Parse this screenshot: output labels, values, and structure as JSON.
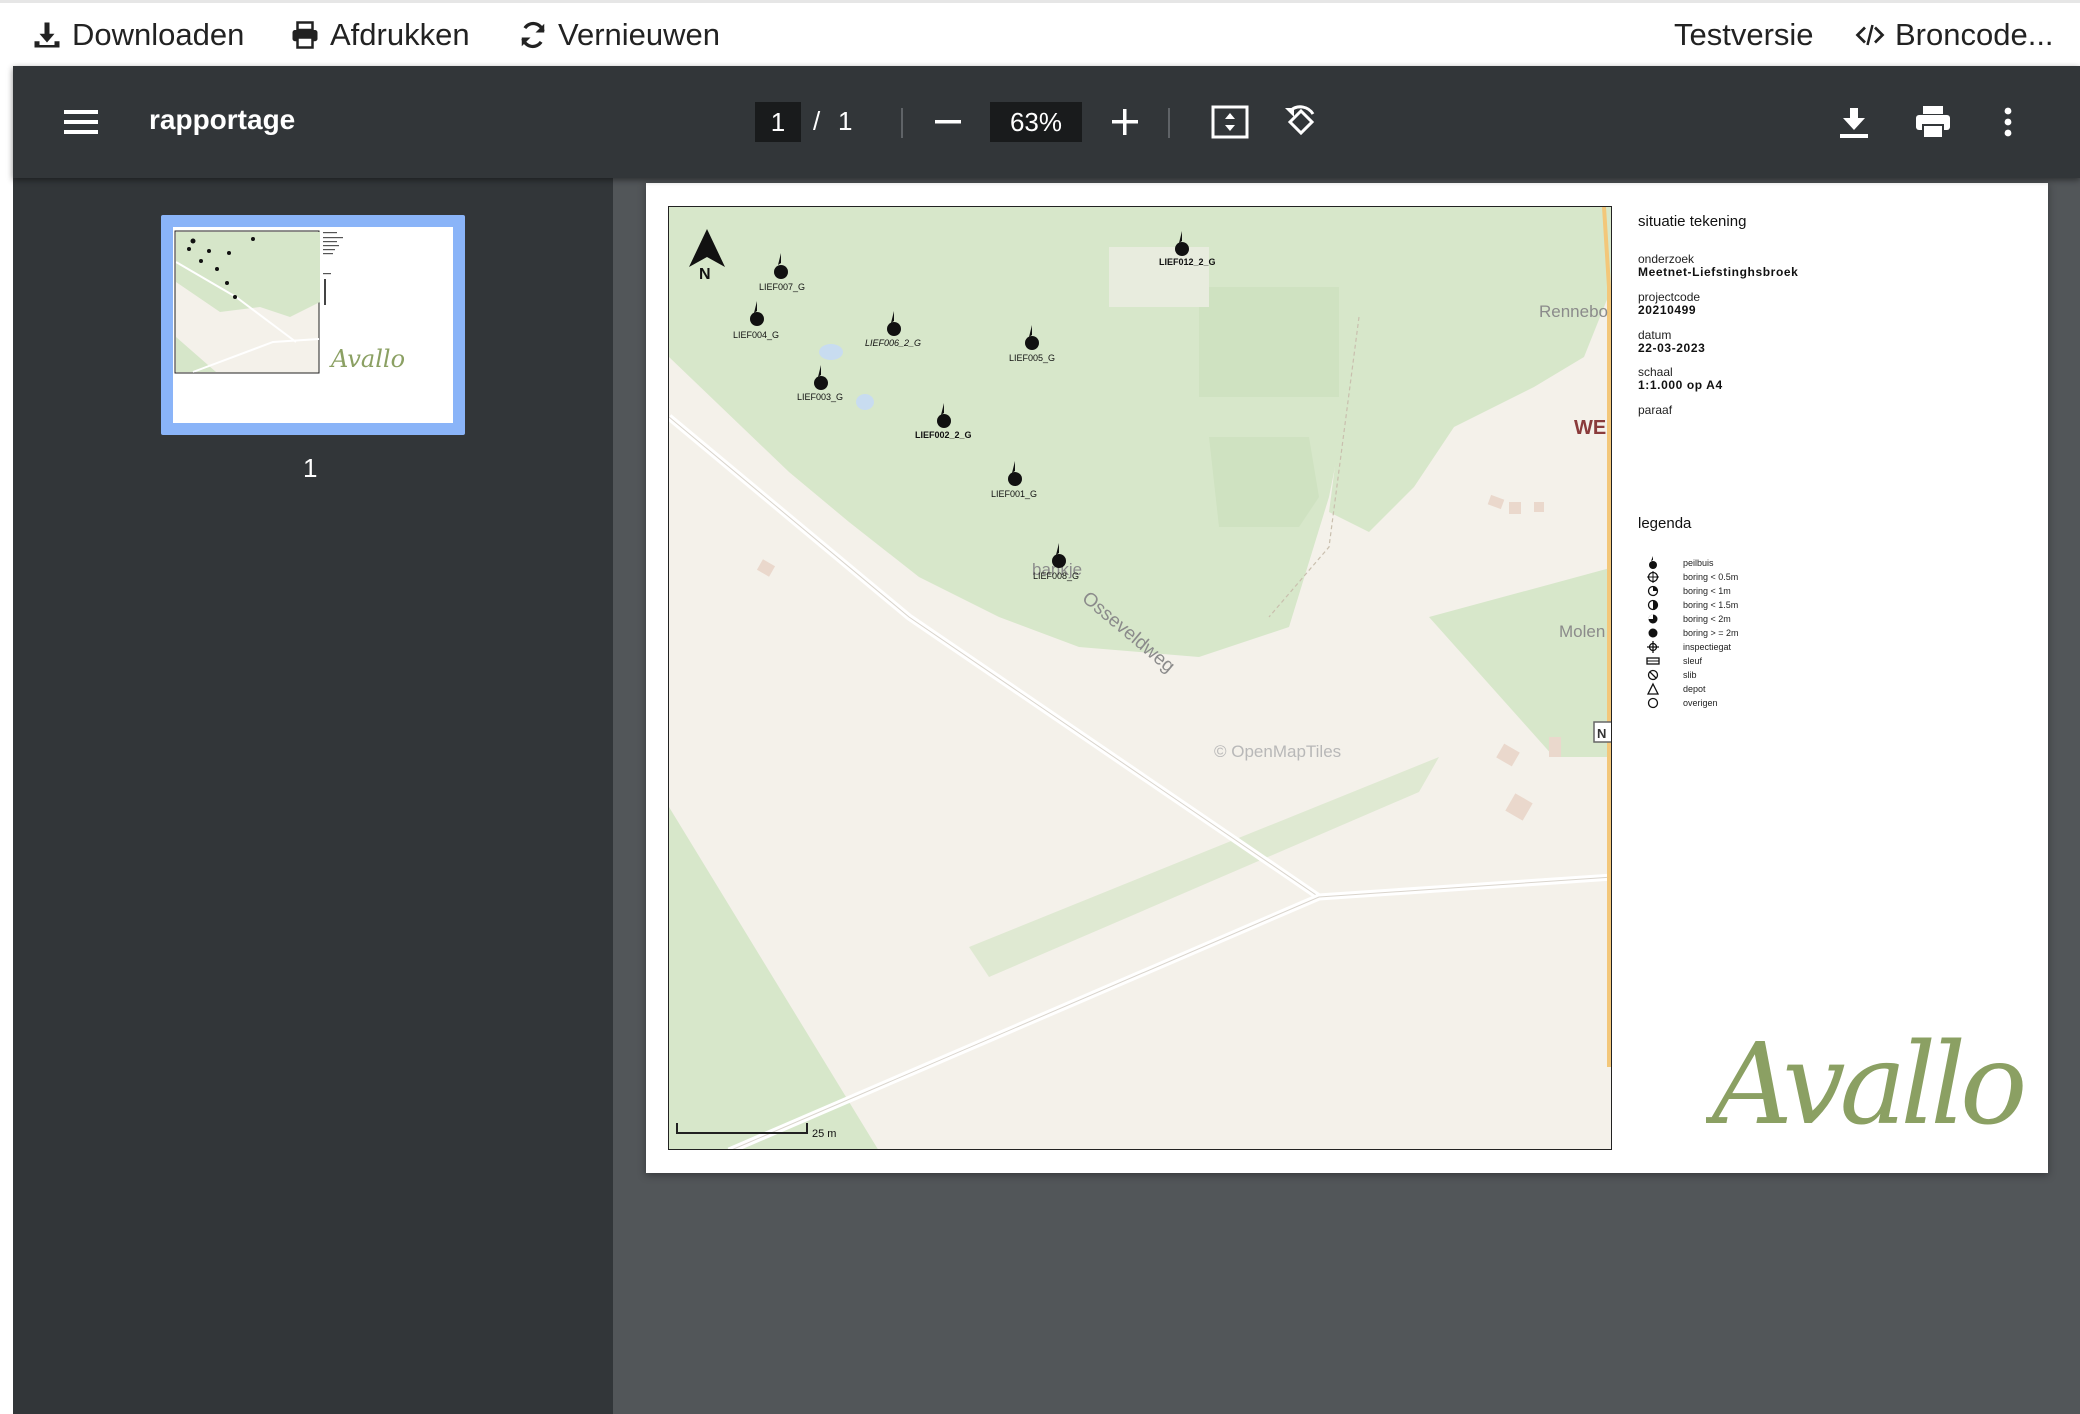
{
  "toolbar": {
    "download_label": "Downloaden",
    "print_label": "Afdrukken",
    "refresh_label": "Vernieuwen",
    "test_label": "Testversie",
    "source_label": "Broncode..."
  },
  "viewer": {
    "title": "rapportage",
    "current_page": "1",
    "page_separator": "/",
    "total_pages": "1",
    "zoom": "63%",
    "thumbnail_label": "1"
  },
  "drawing": {
    "title": "situatie tekening",
    "onderzoek_label": "onderzoek",
    "onderzoek_value": "Meetnet-Liefstinghsbroek",
    "projectcode_label": "projectcode",
    "projectcode_value": "20210499",
    "datum_label": "datum",
    "datum_value": "22-03-2023",
    "schaal_label": "schaal",
    "schaal_value": "1:1.000 op A4",
    "paraaf_label": "paraaf",
    "legend_title": "legenda",
    "legend": [
      "peilbuis",
      "boring < 0.5m",
      "boring < 1m",
      "boring < 1.5m",
      "boring < 2m",
      "boring > = 2m",
      "inspectiegat",
      "sleuf",
      "slib",
      "depot",
      "overigen"
    ],
    "logo_text": "Avallo"
  },
  "map": {
    "north": "N",
    "scale_label": "25 m",
    "attribution": "© OpenMapTiles",
    "road_label": "Osseveldweg",
    "place_labels": [
      "Rennebo",
      "WE",
      "Molen",
      "bankje",
      "N"
    ],
    "points": [
      "LIEF007_G",
      "LIEF012_2_G",
      "LIEF004_G",
      "LIEF006_2_G",
      "LIEF005_G",
      "LIEF003_G",
      "LIEF002_2_G",
      "LIEF001_G",
      "LIEF008_G"
    ]
  },
  "colors": {
    "viewer_bar": "#323639",
    "viewer_bg": "#525659",
    "thumb_highlight": "#8ab4f8",
    "forest": "#d6e6c9",
    "land": "#f4f1ea",
    "logo_green": "#8ba063"
  }
}
